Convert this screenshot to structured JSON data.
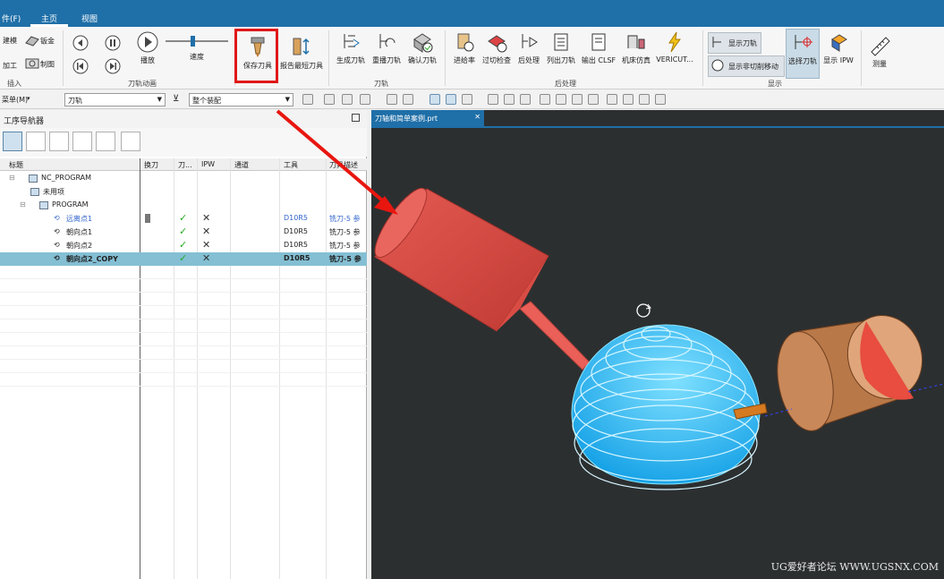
{
  "menu": {
    "file": "件(F)",
    "home": "主页",
    "view": "视图"
  },
  "ribbon": {
    "insert_group": {
      "label": "插入",
      "items": [
        "建模",
        "钣金",
        "加工",
        "制图"
      ]
    },
    "anim_group": {
      "label": "刀轨动画",
      "play": "播放",
      "speed": "速度"
    },
    "save_tool": "保存刀具",
    "report_tool": "报告最短刀具",
    "toolpath_group": {
      "label": "刀轨",
      "items": [
        "生成刀轨",
        "重播刀轨",
        "确认刀轨"
      ]
    },
    "post_group": {
      "label": "后处理",
      "items": [
        "进给率",
        "过切检查",
        "后处理",
        "列出刀轨",
        "输出 CLSF",
        "机床仿真",
        "VERICUT..."
      ]
    },
    "display_group": {
      "label": "显示",
      "items": [
        "显示刀轨",
        "显示非切削移动",
        "选择刀轨",
        "显示 IPW",
        "测量"
      ]
    }
  },
  "toolbar2": {
    "menu_label": "菜单(M)",
    "filter": "刀轨",
    "scope": "整个装配"
  },
  "navigator": {
    "title": "工序导航器",
    "columns": [
      "标题",
      "换刀",
      "刀...",
      "IPW",
      "通道",
      "工具",
      "刀具描述"
    ],
    "rows": [
      {
        "name": "NC_PROGRAM",
        "tool": "",
        "desc": ""
      },
      {
        "name": "未用项",
        "tool": "",
        "desc": ""
      },
      {
        "name": "PROGRAM",
        "tool": "",
        "desc": ""
      },
      {
        "name": "远离点1",
        "tool": "D10R5",
        "desc": "铣刀-5 参"
      },
      {
        "name": "朝向点1",
        "tool": "D10R5",
        "desc": "铣刀-5 参"
      },
      {
        "name": "朝向点2",
        "tool": "D10R5",
        "desc": "铣刀-5 参"
      },
      {
        "name": "朝向点2_COPY",
        "tool": "D10R5",
        "desc": "铣刀-5 参"
      }
    ]
  },
  "viewport": {
    "tab": "刀轴和简单案例.prt"
  },
  "watermark": "UG爱好者论坛 WWW.UGSNX.COM",
  "colors": {
    "accent": "#1f6fa8",
    "highlight": "#e01818",
    "selected_row": "#84bfd4",
    "toolpath": "#2bb3f0",
    "tool": "#e8524a"
  }
}
